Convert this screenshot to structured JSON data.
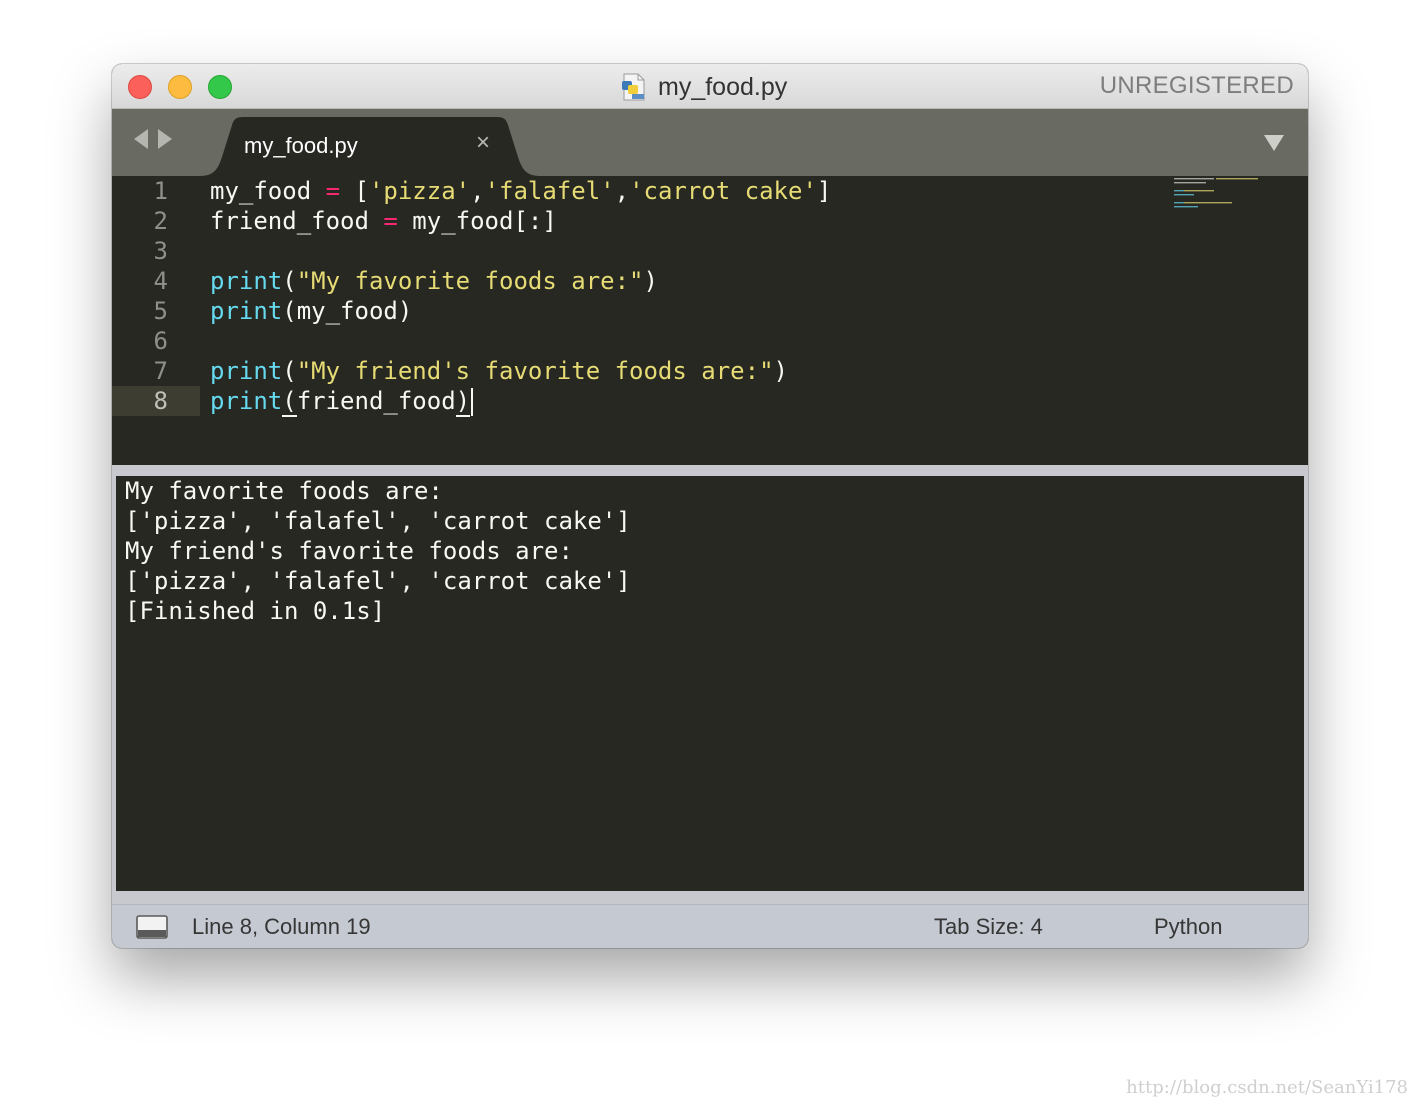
{
  "window": {
    "title": "my_food.py",
    "registration_status": "UNREGISTERED"
  },
  "tabs": [
    {
      "label": "my_food.py",
      "close_glyph": "×",
      "active": true
    }
  ],
  "editor": {
    "active_line": 8,
    "lines": [
      {
        "number": "1",
        "code": "my_food = ['pizza','falafel','carrot cake']"
      },
      {
        "number": "2",
        "code": "friend_food = my_food[:]"
      },
      {
        "number": "3",
        "code": ""
      },
      {
        "number": "4",
        "code": "print(\"My favorite foods are:\")"
      },
      {
        "number": "5",
        "code": "print(my_food)"
      },
      {
        "number": "6",
        "code": ""
      },
      {
        "number": "7",
        "code": "print(\"My friend's favorite foods are:\")"
      },
      {
        "number": "8",
        "code": "print(friend_food)"
      }
    ]
  },
  "output": {
    "lines": [
      "My favorite foods are:",
      "['pizza', 'falafel', 'carrot cake']",
      "My friend's favorite foods are:",
      "['pizza', 'falafel', 'carrot cake']",
      "[Finished in 0.1s]"
    ]
  },
  "statusbar": {
    "position": "Line 8, Column 19",
    "tab_size": "Tab Size: 4",
    "syntax": "Python"
  },
  "watermark": "http://blog.csdn.net/SeanYi178",
  "colors": {
    "background": "#272822",
    "keyword_function": "#66d9ef",
    "string": "#e6db74",
    "operator": "#f92672",
    "text": "#f8f8f2"
  }
}
